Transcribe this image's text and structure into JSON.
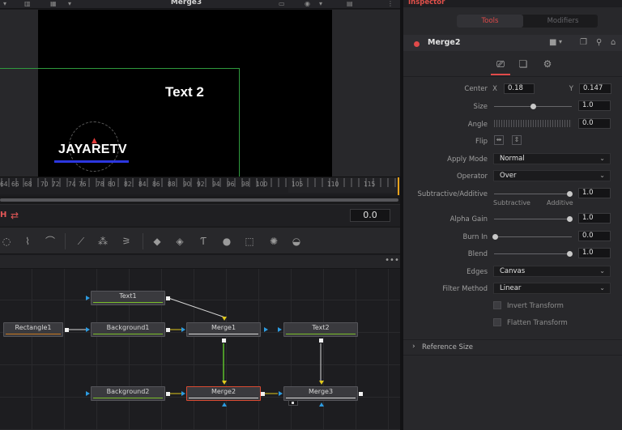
{
  "viewer": {
    "title": "Merge3",
    "canvas_text": "Text 2",
    "logo_text": "JAYARETV"
  },
  "timeline": {
    "ticks": [
      "64",
      "66",
      "68",
      "70",
      "72",
      "74",
      "76",
      "78",
      "80",
      "82",
      "84",
      "86",
      "88",
      "90",
      "92",
      "94",
      "96",
      "98",
      "100",
      "105",
      "110",
      "115"
    ],
    "playhead_color": "#e8a21c"
  },
  "transport": {
    "h_label": "H",
    "loop_icon": "loop-icon",
    "time_value": "0.0"
  },
  "node_editor": {
    "menu_label": "•••",
    "nodes": {
      "text1": "Text1",
      "rectangle1": "Rectangle1",
      "background1": "Background1",
      "merge1": "Merge1",
      "text2": "Text2",
      "background2": "Background2",
      "merge2": "Merge2",
      "merge3": "Merge3"
    }
  },
  "inspector": {
    "title": "Inspector",
    "tabs": {
      "tools": "Tools",
      "modifiers": "Modifiers"
    },
    "node_name": "Merge2",
    "accent_color": "#e04a4a",
    "params": {
      "center_label": "Center",
      "center_x_label": "X",
      "center_x": "0.18",
      "center_y_label": "Y",
      "center_y": "0.147",
      "size_label": "Size",
      "size_value": "1.0",
      "angle_label": "Angle",
      "angle_value": "0.0",
      "flip_label": "Flip",
      "apply_mode_label": "Apply Mode",
      "apply_mode_value": "Normal",
      "operator_label": "Operator",
      "operator_value": "Over",
      "subtractive_additive_label": "Subtractive/Additive",
      "subtractive_additive_value": "1.0",
      "subtractive_note": "Subtractive",
      "additive_note": "Additive",
      "alpha_gain_label": "Alpha Gain",
      "alpha_gain_value": "1.0",
      "burn_in_label": "Burn In",
      "burn_in_value": "0.0",
      "blend_label": "Blend",
      "blend_value": "1.0",
      "edges_label": "Edges",
      "edges_value": "Canvas",
      "filter_method_label": "Filter Method",
      "filter_method_value": "Linear",
      "invert_transform_label": "Invert Transform",
      "flatten_transform_label": "Flatten Transform"
    },
    "reference_size_label": "Reference Size"
  }
}
